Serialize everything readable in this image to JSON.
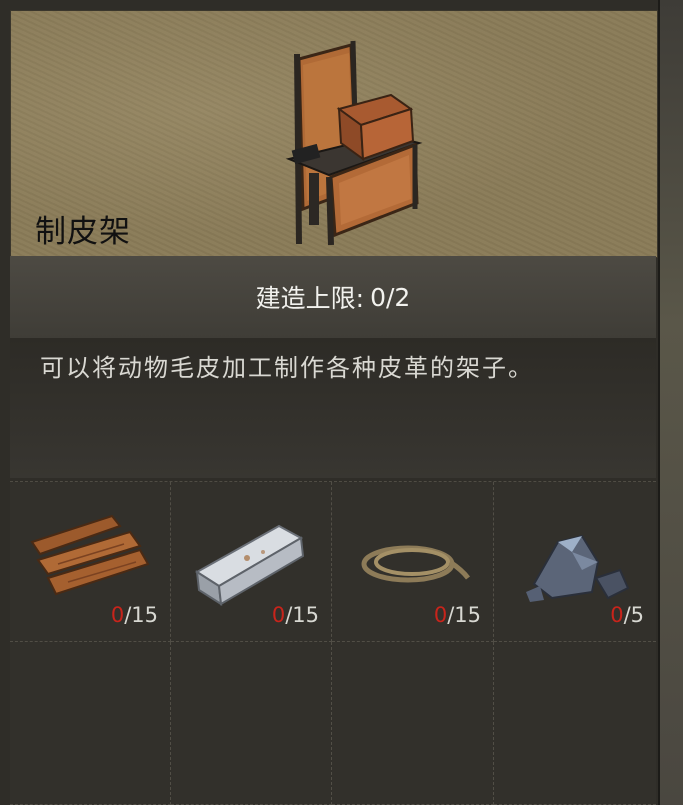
{
  "building": {
    "name": "制皮架",
    "limit_label": "建造上限:",
    "limit_value": "0/2",
    "description": "可以将动物毛皮加工制作各种皮革的架子。"
  },
  "materials": [
    {
      "icon": "wood-planks-icon",
      "have": "0",
      "need": "/15"
    },
    {
      "icon": "metal-ingot-icon",
      "have": "0",
      "need": "/15"
    },
    {
      "icon": "rope-icon",
      "have": "0",
      "need": "/15"
    },
    {
      "icon": "ore-icon",
      "have": "0",
      "need": "/5"
    }
  ],
  "colors": {
    "missing_count": "#c8241b",
    "hero_bg": "#8a7b58"
  }
}
